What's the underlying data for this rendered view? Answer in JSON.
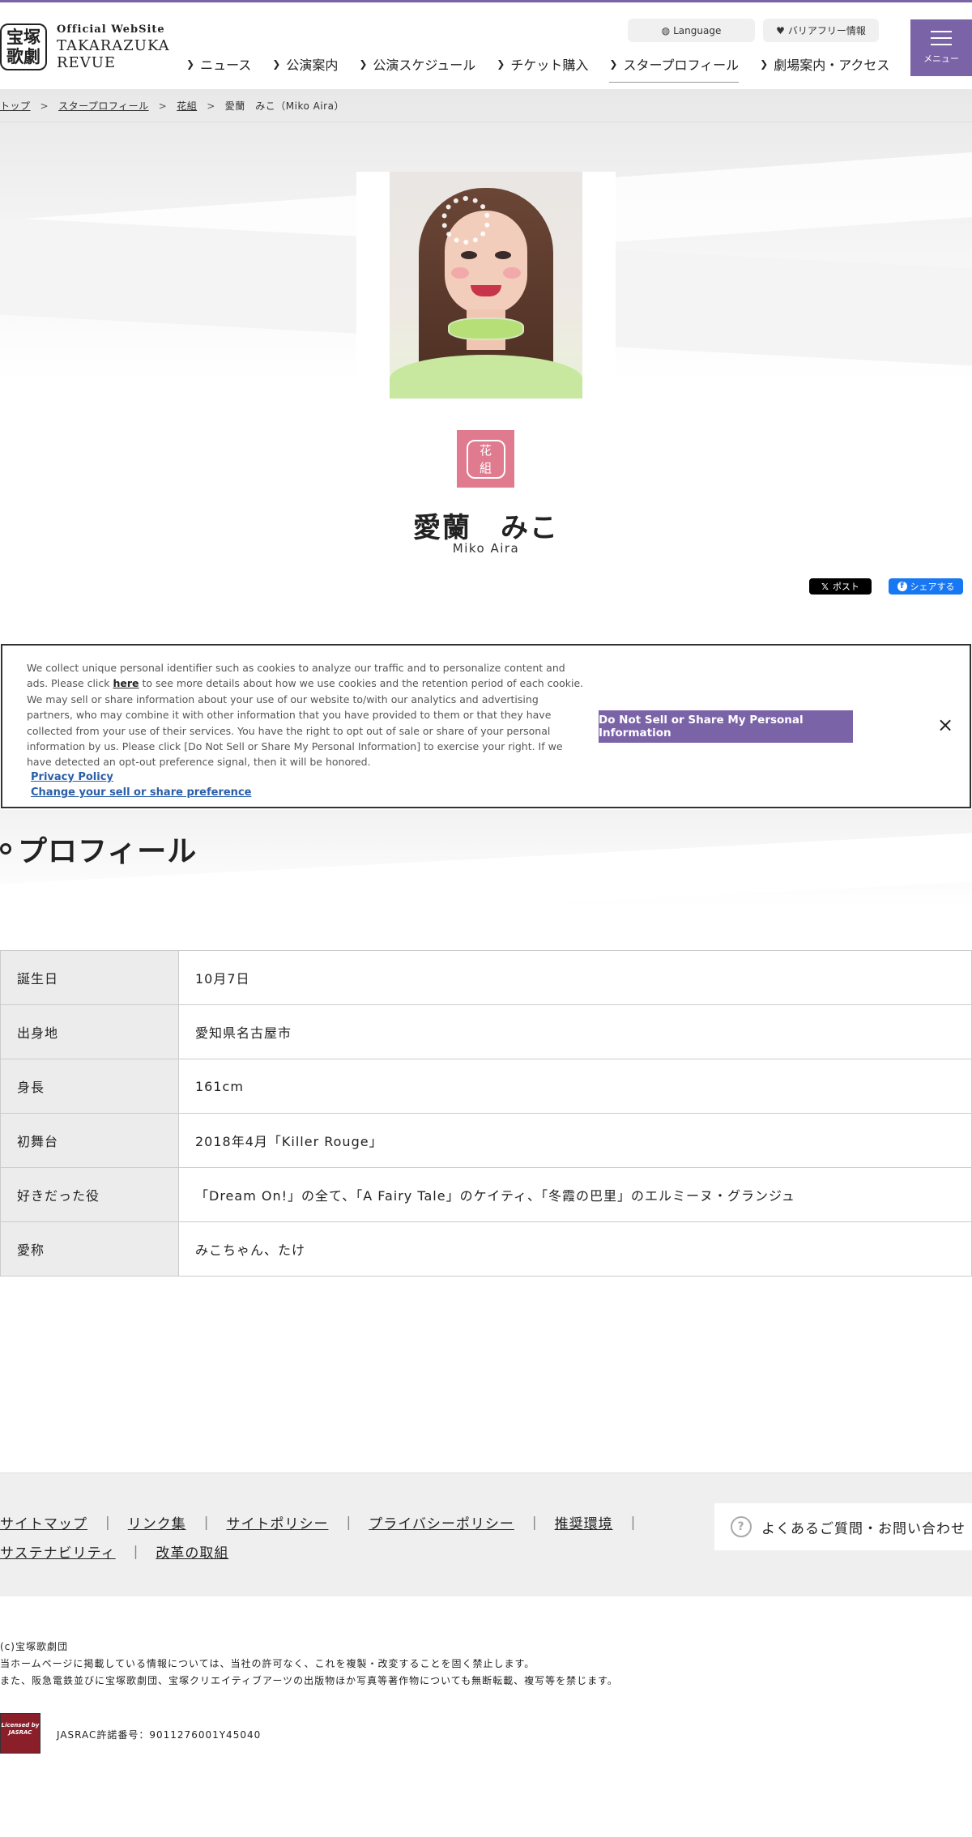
{
  "header": {
    "logo": {
      "mark_line1": "宝塚",
      "mark_line2": "歌劇",
      "official": "Official WebSite",
      "name_line1": "TAKARAZUKA",
      "name_line2": "REVUE"
    },
    "utility": {
      "language": "Language",
      "barrier_free": "バリアフリー情報"
    },
    "nav": [
      {
        "label": "ニュース"
      },
      {
        "label": "公演案内"
      },
      {
        "label": "公演スケジュール"
      },
      {
        "label": "チケット購入"
      },
      {
        "label": "スタープロフィール",
        "active": true
      },
      {
        "label": "劇場案内・アクセス"
      }
    ],
    "menu_label": "メニュー"
  },
  "breadcrumb": {
    "items": [
      "トップ",
      "スタープロフィール",
      "花組"
    ],
    "current": "愛蘭　みこ（Miko Aira）",
    "separator": ">"
  },
  "star": {
    "troupe_icon_line1": "花",
    "troupe_icon_line2": "組",
    "name_jp": "愛蘭　みこ",
    "name_en": "Miko Aira"
  },
  "share": {
    "x_label": "ポスト",
    "fb_label": "シェアする"
  },
  "cookie": {
    "text_before_link": "We collect unique personal identifier such as cookies to analyze our traffic and to personalize content and ads. Please click ",
    "here": "here",
    "text_after_link": " to see more details about how we use cookies and the retention period of each cookie. We may sell or share information about your use of our website to/with our analytics and advertising partners, who may combine it with other information that you have provided to them or that they have collected from your use of their services. You have the right to opt out of sale or share of your personal information by us. Please click [Do Not Sell or Share My Personal Information] to exercise your right. If we have detected an opt-out preference signal, then it will be honored.",
    "privacy_policy": "Privacy Policy",
    "change_preference": "Change your sell or share preference",
    "dns_button": "Do Not Sell or Share My Personal Information",
    "close_symbol": "×"
  },
  "profile": {
    "title": "プロフィール",
    "rows": [
      {
        "key": "誕生日",
        "value": "10月7日"
      },
      {
        "key": "出身地",
        "value": "愛知県名古屋市"
      },
      {
        "key": "身長",
        "value": "161cm"
      },
      {
        "key": "初舞台",
        "value": "2018年4月「Killer Rouge」"
      },
      {
        "key": "好きだった役",
        "value": "「Dream On!」の全て、「A Fairy Tale」のケイティ、「冬霞の巴里」のエルミーヌ・グランジュ"
      },
      {
        "key": "愛称",
        "value": "みこちゃん、たけ"
      }
    ]
  },
  "footer": {
    "links_row1": [
      "サイトマップ",
      "リンク集",
      "サイトポリシー",
      "プライバシーポリシー",
      "推奨環境"
    ],
    "links_row2": [
      "サステナビリティ",
      "改革の取組"
    ],
    "faq": "よくあるご質問・お問い合わせ",
    "copyright_line1": "(c)宝塚歌劇団",
    "copyright_line2": "当ホームページに掲載している情報については、当社の許可なく、これを複製・改変することを固く禁止します。",
    "copyright_line3": "また、阪急電鉄並びに宝塚歌劇団、宝塚クリエイティブアーツの出版物ほか写真等著作物についても無断転載、複写等を禁じます。",
    "jasrac_logo_text": "Licensed by JASRAC",
    "jasrac": "JASRAC許諾番号：9011276001Y45040"
  },
  "colors": {
    "brand_purple": "#7b63a8",
    "troupe_pink": "#e07a8e",
    "facebook_blue": "#1877f2"
  }
}
